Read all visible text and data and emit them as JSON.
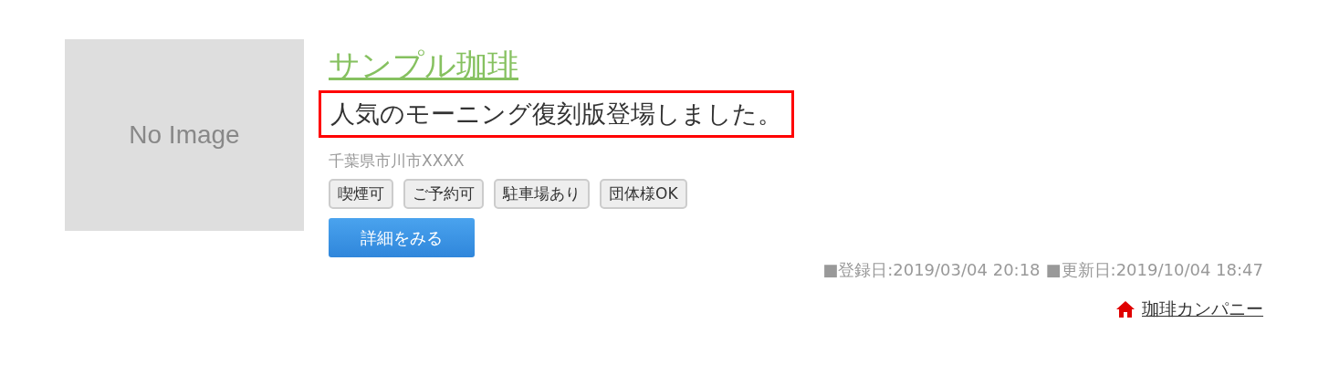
{
  "listing": {
    "image_placeholder": "No Image",
    "title": "サンプル珈琲",
    "headline": "人気のモーニング復刻版登場しました。",
    "address": "千葉県市川市XXXX",
    "tags": [
      "喫煙可",
      "ご予約可",
      "駐車場あり",
      "団体様OK"
    ],
    "detail_button": "詳細をみる",
    "registered": "■登録日:2019/03/04 20:18",
    "updated": "■更新日:2019/10/04 18:47",
    "company_link": "珈琲カンパニー"
  }
}
